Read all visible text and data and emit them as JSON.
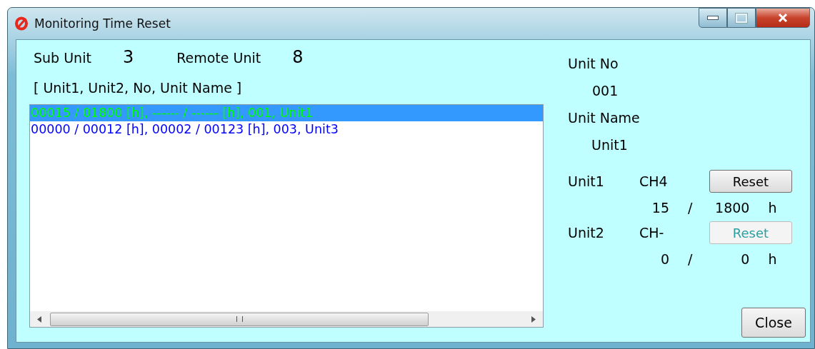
{
  "window": {
    "title": "Monitoring Time Reset"
  },
  "header": {
    "sub_unit_label": "Sub Unit",
    "sub_unit_value": "3",
    "remote_unit_label": "Remote Unit",
    "remote_unit_value": "8"
  },
  "list": {
    "heading": "[ Unit1, Unit2, No, Unit Name ]",
    "rows": [
      {
        "text": "00015 / 01800 [h], ------ / ------ [h], 001, Unit1",
        "selected": true
      },
      {
        "text": "00000 / 00012 [h], 00002 / 00123 [h], 003, Unit3",
        "selected": false
      }
    ]
  },
  "details": {
    "unit_no_label": "Unit No",
    "unit_no": "001",
    "unit_name_label": "Unit Name",
    "unit_name": "Unit1",
    "units": [
      {
        "name": "Unit1",
        "channel": "CH4",
        "button": "Reset",
        "disabled": false,
        "used": "15",
        "sep": "/",
        "limit": "1800",
        "unit": "h"
      },
      {
        "name": "Unit2",
        "channel": "CH-",
        "button": "Reset",
        "disabled": true,
        "used": "0",
        "sep": "/",
        "limit": "0",
        "unit": "h"
      }
    ]
  },
  "buttons": {
    "close": "Close"
  }
}
